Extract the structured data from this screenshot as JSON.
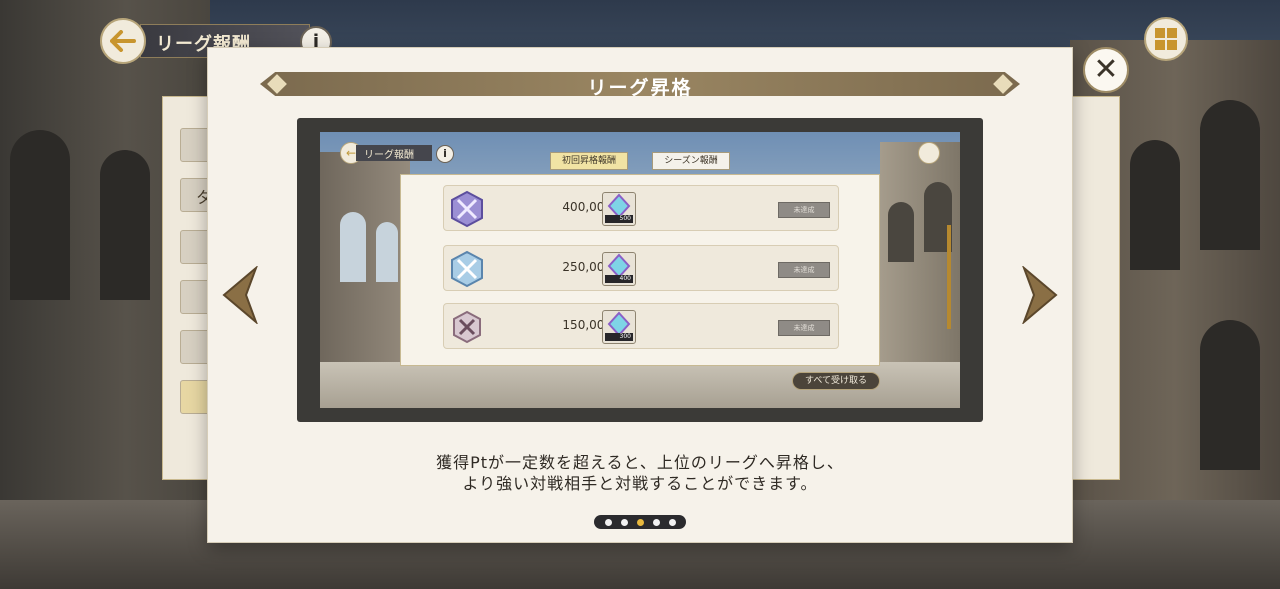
{
  "background": {
    "header_title": "リーグ報酬",
    "info_label": "i",
    "side_tab_label": "タ"
  },
  "modal": {
    "title": "リーグ昇格",
    "close_label": "✕",
    "description_line1": "獲得Ptが一定数を超えると、上位のリーグへ昇格し、",
    "description_line2": "より強い対戦相手と対戦することができます。",
    "page_indicator": {
      "total": 5,
      "current": 3
    }
  },
  "preview": {
    "header_title": "リーグ報酬",
    "info_label": "i",
    "tabs": [
      "初回昇格報酬",
      "シーズン報酬"
    ],
    "rows": [
      {
        "points": "400,000Pt",
        "reward_count": "500",
        "claim_label": "未達成"
      },
      {
        "points": "250,000Pt",
        "reward_count": "400",
        "claim_label": "未達成"
      },
      {
        "points": "150,000Pt",
        "reward_count": "300",
        "claim_label": "未達成"
      }
    ],
    "claim_all_label": "すべて受け取る"
  },
  "icons": {
    "back": "arrow-left-icon",
    "info": "info-icon",
    "menu": "grid-menu-icon",
    "close": "close-icon",
    "prev": "chevron-left-icon",
    "next": "chevron-right-icon"
  },
  "colors": {
    "accent_gold": "#e9b93e",
    "title_bar": "#8b7857",
    "modal_bg": "#f6f2ea"
  }
}
